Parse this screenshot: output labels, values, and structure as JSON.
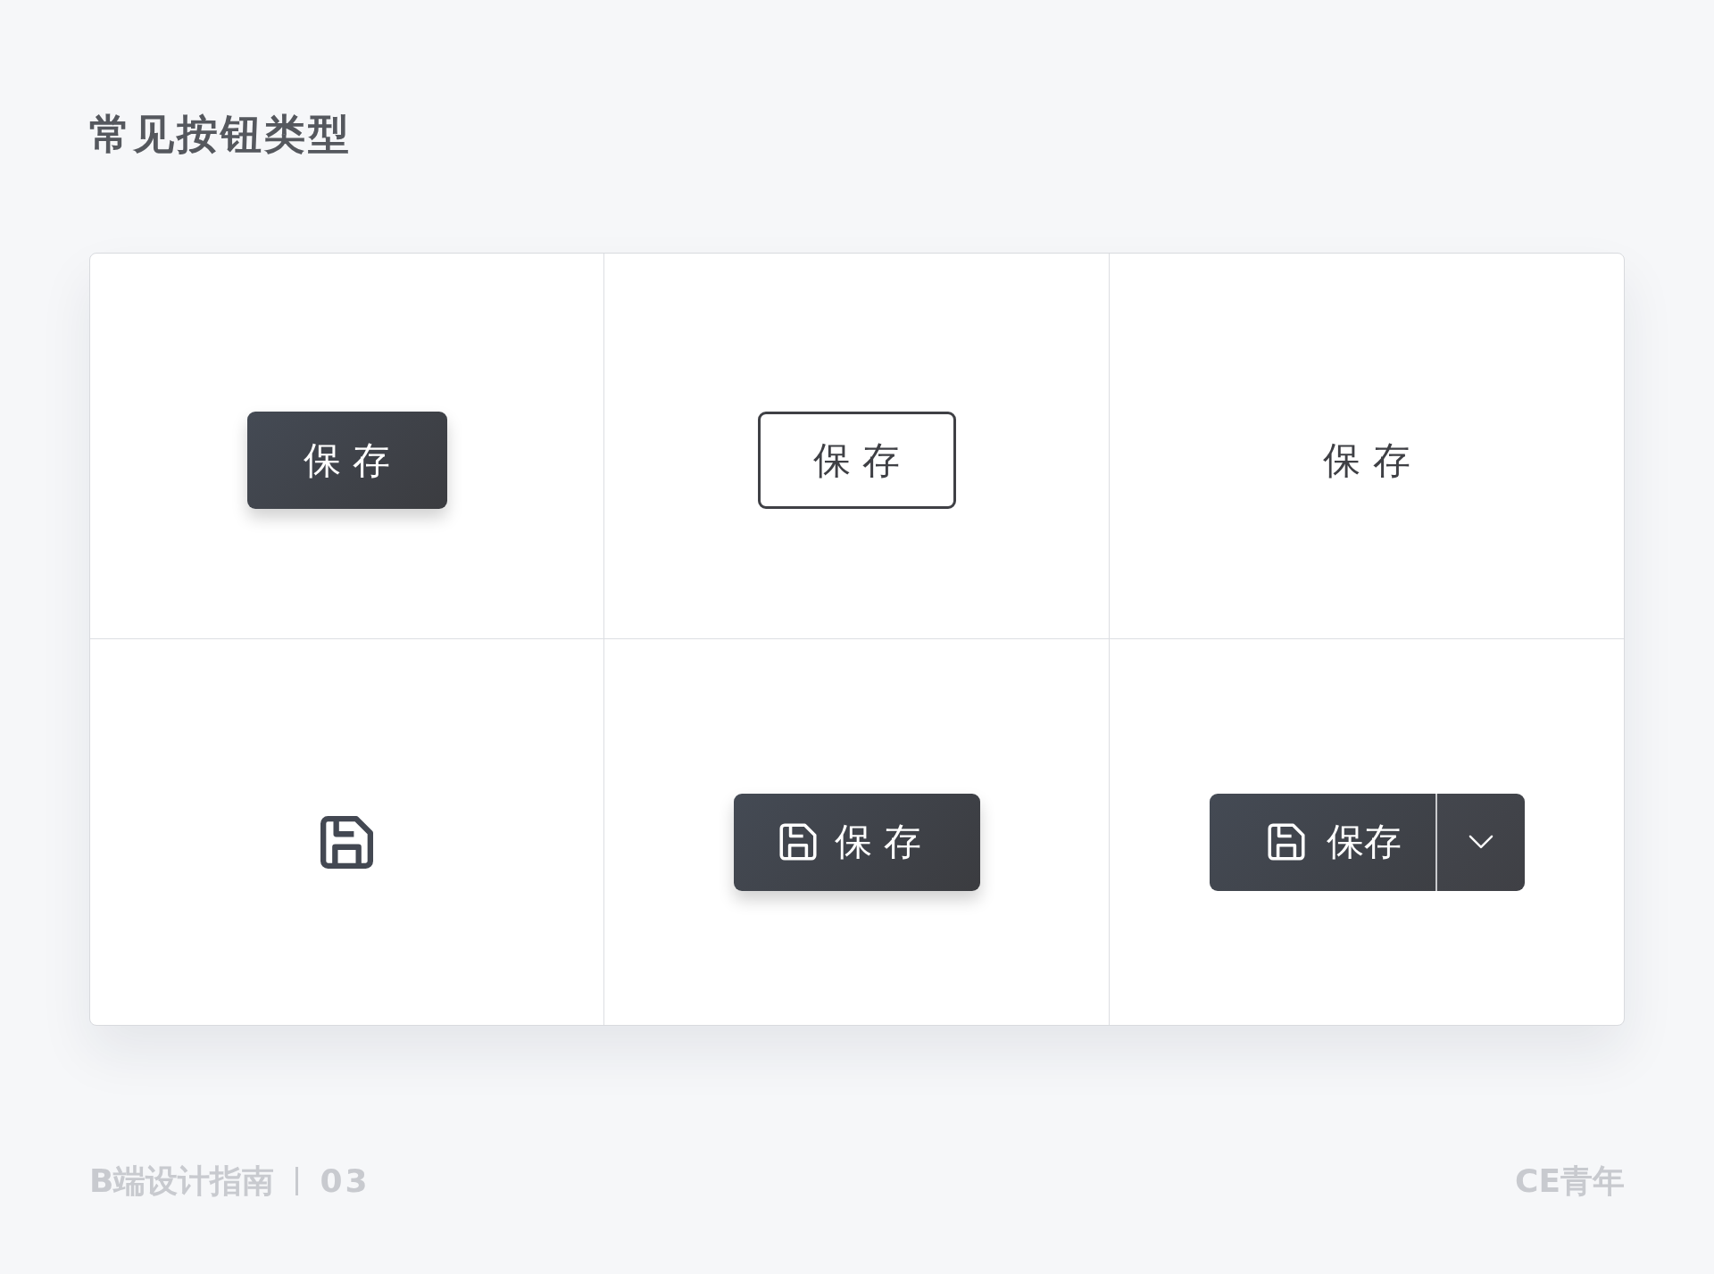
{
  "title": "常见按钮类型",
  "buttons": [
    {
      "kind": "primary",
      "label": "保 存"
    },
    {
      "kind": "outline",
      "label": "保 存"
    },
    {
      "kind": "text",
      "label": "保 存"
    },
    {
      "kind": "icon"
    },
    {
      "kind": "icon_primary",
      "label": "保 存"
    },
    {
      "kind": "split",
      "label": "保存"
    }
  ],
  "footer": {
    "guide_title": "B端设计指南",
    "page_number": "03",
    "author": "CE青年"
  }
}
